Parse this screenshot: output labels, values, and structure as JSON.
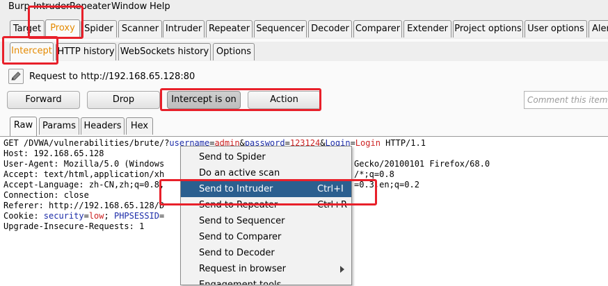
{
  "menubar": [
    "Burp",
    "Intruder",
    "Repeater",
    "Window",
    "Help"
  ],
  "main_tabs": [
    "Target",
    "Proxy",
    "Spider",
    "Scanner",
    "Intruder",
    "Repeater",
    "Sequencer",
    "Decoder",
    "Comparer",
    "Extender",
    "Project options",
    "User options",
    "Aler"
  ],
  "active_main_tab": "Proxy",
  "proxy_tabs": [
    "Intercept",
    "HTTP history",
    "WebSockets history",
    "Options"
  ],
  "active_proxy_tab": "Intercept",
  "request_info": "Request to http://192.168.65.128:80",
  "buttons": {
    "forward": "Forward",
    "drop": "Drop",
    "intercept": "Intercept is on",
    "action": "Action"
  },
  "comment_placeholder": "Comment this item",
  "view_tabs": [
    "Raw",
    "Params",
    "Headers",
    "Hex"
  ],
  "active_view_tab": "Raw",
  "request": {
    "line1": {
      "prefix": "GET /DVWA/vulnerabilities/brute/?",
      "k1": "username",
      "v1": "admin",
      "k2": "password",
      "v2": "123124",
      "k3": "Login",
      "v3": "Login",
      "suffix": " HTTP/1.1"
    },
    "host": "Host: 192.168.65.128",
    "user_agent_a": "User-Agent: Mozilla/5.0 (Windows",
    "user_agent_b": "Gecko/20100101 Firefox/68.0",
    "accept_a": "Accept: text/html,application/xh",
    "accept_b": "/*;q=0.8",
    "lang_a": "Accept-Language: zh-CN,zh;q=0.8,",
    "lang_b": "=0.3,en;q=0.2",
    "connection": "Connection: close",
    "referer": "Referer: http://192.168.65.128/D",
    "cookie_prefix": "Cookie: ",
    "cookie_k1": "security",
    "cookie_v1": "low",
    "cookie_k2": "PHPSESSID",
    "upgrade": "Upgrade-Insecure-Requests: 1"
  },
  "context_menu": [
    {
      "label": "Send to Spider",
      "shortcut": ""
    },
    {
      "label": "Do an active scan",
      "shortcut": ""
    },
    {
      "label": "Send to Intruder",
      "shortcut": "Ctrl+I"
    },
    {
      "label": "Send to Repeater",
      "shortcut": "Ctrl+R"
    },
    {
      "label": "Send to Sequencer",
      "shortcut": ""
    },
    {
      "label": "Send to Comparer",
      "shortcut": ""
    },
    {
      "label": "Send to Decoder",
      "shortcut": ""
    },
    {
      "label": "Request in browser",
      "shortcut": "",
      "submenu": true
    },
    {
      "label": "Engagement tools",
      "shortcut": ""
    }
  ],
  "highlighted_menu_item": "Send to Intruder",
  "colors": {
    "accent_orange": "#e58a00",
    "highlight_blue": "#2b5f8f",
    "annotation_red": "#e8202a",
    "param_blue": "#1c2ca8",
    "value_red": "#cc2222"
  }
}
